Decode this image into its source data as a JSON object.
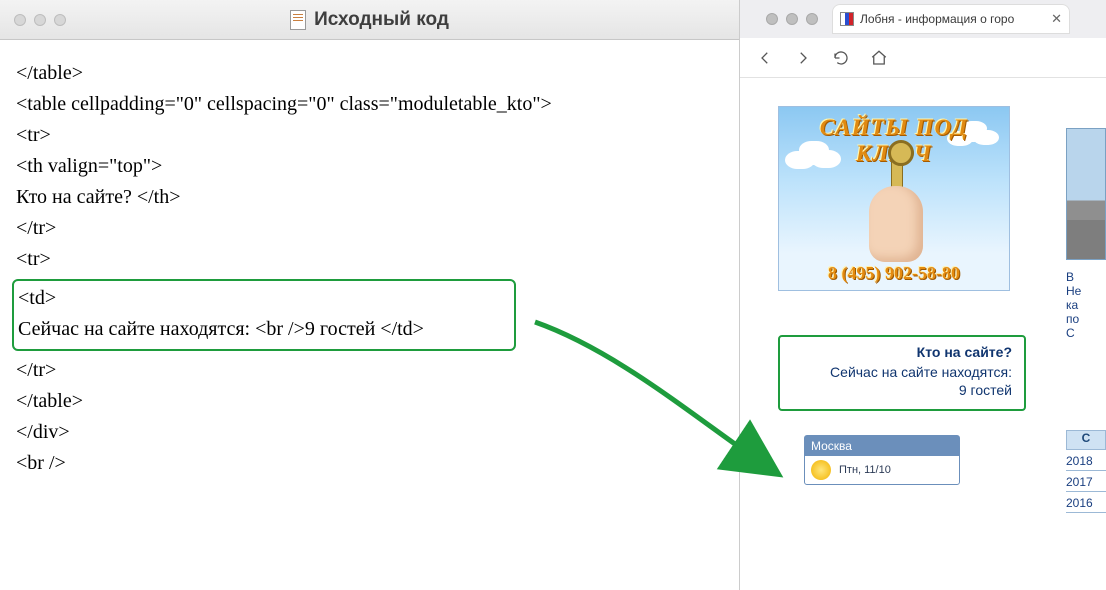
{
  "left_window": {
    "title": "Исходный код",
    "code_lines": {
      "l0": "</table>",
      "l1": "<table cellpadding=\"0\" cellspacing=\"0\" class=\"moduletable_kto\">",
      "l2": "<tr>",
      "l3": "<th valign=\"top\">",
      "l4": "Кто на сайте? </th>",
      "l5": "</tr>",
      "l6": "<tr>",
      "highlighted": {
        "h1": "<td>",
        "h2": "Сейчас на сайте находятся: <br />9 гостей </td>"
      },
      "l7": "</tr>",
      "l8": "</table>",
      "l9": "</div>",
      "l10": "<br />"
    }
  },
  "right_window": {
    "tab_title": "Лобня - информация о горо",
    "banner": {
      "arc_text": "САЙТЫ ПОД КЛЮЧ",
      "phone": "8 (495) 902-58-80"
    },
    "who_online": {
      "title": "Кто на сайте?",
      "line1": "Сейчас на сайте находятся:",
      "line2": "9 гостей"
    },
    "weather": {
      "city": "Москва",
      "date": "Птн, 11/10"
    },
    "edge": {
      "snip1": "В",
      "snip2": "Не",
      "snip3": "ка",
      "snip4": "по",
      "snip5": "С",
      "head": "С",
      "y1": "2018",
      "y2": "2017",
      "y3": "2016"
    }
  }
}
